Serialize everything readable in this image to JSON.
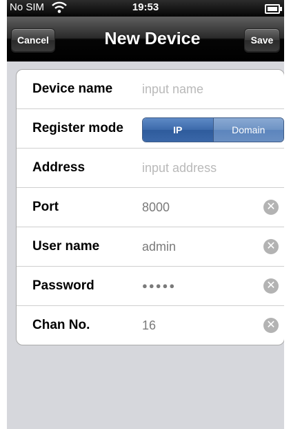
{
  "status_bar": {
    "carrier": "No SIM",
    "time": "19:53",
    "icons": [
      "wifi-icon",
      "battery-icon"
    ]
  },
  "nav": {
    "title": "New Device",
    "cancel_label": "Cancel",
    "save_label": "Save"
  },
  "form": {
    "device_name": {
      "label": "Device name",
      "placeholder": "input name"
    },
    "register_mode": {
      "label": "Register mode",
      "options": [
        "IP",
        "Domain"
      ],
      "selected": "IP"
    },
    "address": {
      "label": "Address",
      "placeholder": "input address"
    },
    "port": {
      "label": "Port",
      "value": "8000"
    },
    "user_name": {
      "label": "User name",
      "value": "admin"
    },
    "password": {
      "label": "Password",
      "masked_value": "●●●●●"
    },
    "chan_no": {
      "label": "Chan No.",
      "value": "16"
    }
  },
  "colors": {
    "background": "#d6d7dc",
    "segment_selected": "#3c6aab",
    "segment_normal": "#6e93c4",
    "placeholder": "#b9b9b9",
    "value_text": "#7a7a7a"
  }
}
